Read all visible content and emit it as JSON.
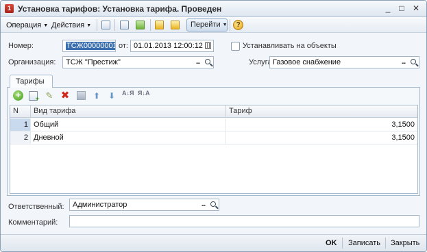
{
  "window": {
    "title": "Установка тарифов: Установка тарифа. Проведен",
    "app_icon_glyph": "1"
  },
  "toolbar": {
    "operation_label": "Операция",
    "actions_label": "Действия",
    "goto_label": "Перейти",
    "help_glyph": "?"
  },
  "form": {
    "number_label": "Номер:",
    "number_value": "ТСЖ00000001",
    "from_label": "от:",
    "date_value": "01.01.2013 12:00:12",
    "set_on_objects_label": "Устанавливать на объекты",
    "set_on_objects_checked": false,
    "organization_label": "Организация:",
    "organization_value": "ТСЖ \"Престиж\"",
    "service_label": "Услуга:",
    "service_value": "Газовое снабжение",
    "responsible_label": "Ответственный:",
    "responsible_value": "Администратор",
    "comment_label": "Комментарий:",
    "comment_value": ""
  },
  "tabs": [
    {
      "label": "Тарифы",
      "active": true
    }
  ],
  "grid": {
    "columns": [
      "N",
      "Вид тарифа",
      "Тариф"
    ],
    "rows": [
      {
        "n": "1",
        "type": "Общий",
        "rate": "3,1500",
        "selected": true
      },
      {
        "n": "2",
        "type": "Дневной",
        "rate": "3,1500",
        "selected": false
      }
    ]
  },
  "footer": {
    "ok_label": "OK",
    "save_label": "Записать",
    "close_label": "Закрыть"
  },
  "icons": {
    "dots": "...",
    "minimize": "_",
    "maximize": "□",
    "close": "✕",
    "add": "+",
    "edit": "✎",
    "delete": "✖",
    "move_up": "⬆",
    "move_down": "⬇",
    "sort_asc": "А↓Я",
    "sort_desc": "Я↓А"
  },
  "colors": {
    "selection": "#3a6fb0",
    "window_border": "#8aa0b8",
    "delete_icon": "#d1281d",
    "add_icon": "#3f9a1c"
  }
}
